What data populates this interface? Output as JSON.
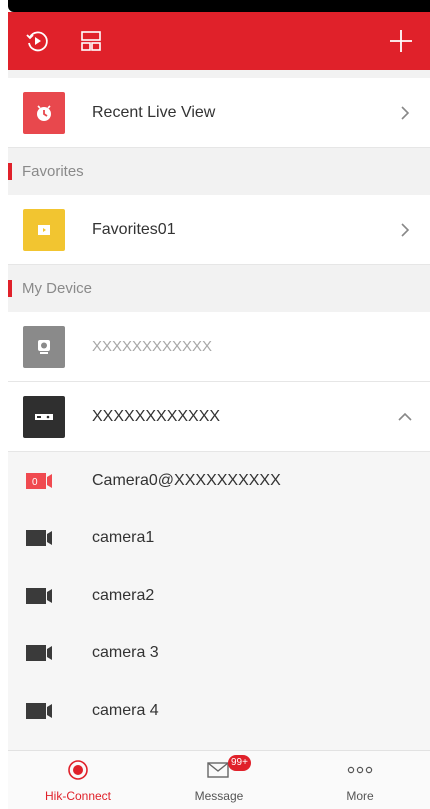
{
  "colors": {
    "brand": "#e0212a",
    "favorites_tile": "#f2c530",
    "recent_tile": "#e8484d"
  },
  "header": {
    "icons": [
      "history-icon",
      "layout-icon",
      "add-icon"
    ]
  },
  "recent": {
    "label": "Recent Live View"
  },
  "favorites": {
    "section_title": "Favorites",
    "items": [
      {
        "label": "Favorites01"
      }
    ]
  },
  "devices": {
    "section_title": "My Device",
    "items": [
      {
        "label": "XXXXXXXXXXXX",
        "state": "offline"
      },
      {
        "label": "XXXXXXXXXXXX",
        "state": "expanded"
      }
    ],
    "cameras": [
      {
        "label": "Camera0@XXXXXXXXXX",
        "icon_badge": "0"
      },
      {
        "label": "camera1"
      },
      {
        "label": "camera2"
      },
      {
        "label": "camera 3"
      },
      {
        "label": "camera 4"
      }
    ]
  },
  "tabs": [
    {
      "label": "Hik-Connect",
      "active": true
    },
    {
      "label": "Message",
      "badge": "99+"
    },
    {
      "label": "More"
    }
  ]
}
